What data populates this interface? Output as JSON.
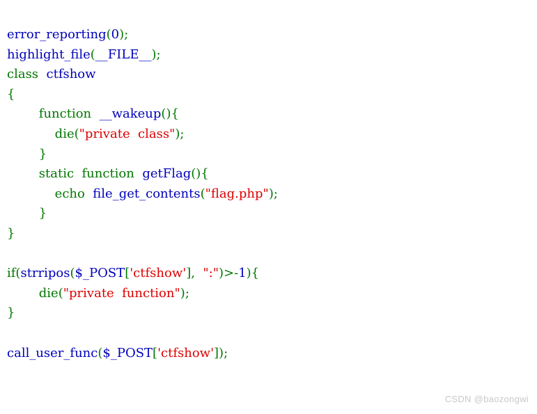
{
  "page": {
    "background_color": "#ffffff",
    "title": "PHP source highlight output"
  },
  "theme": {
    "default_color": "#0000BB",
    "keyword_color": "#007700",
    "string_color": "#DD0000",
    "comment_color": "#FF8000",
    "background_color": "#ffffff"
  },
  "watermark": {
    "text": "CSDN @baozongwi"
  },
  "code": {
    "language": "php",
    "plain_text": "error_reporting(0);\nhighlight_file(__FILE__);\nclass  ctfshow\n{\n        function  __wakeup(){\n            die(\"private  class\");\n        }\n        static  function  getFlag(){\n            echo  file_get_contents(\"flag.php\");\n        }\n}\n\nif(strripos($_POST['ctfshow'],  \":\")>-1){\n        die(\"private  function\");\n}\n\ncall_user_func($_POST['ctfshow']);",
    "lines": [
      {
        "indent": "",
        "tokens": [
          {
            "text": "error_reporting",
            "type": "default"
          },
          {
            "text": "(",
            "type": "keyword"
          },
          {
            "text": "0",
            "type": "default"
          },
          {
            "text": ")",
            "type": "keyword"
          },
          {
            "text": ";",
            "type": "keyword"
          }
        ]
      },
      {
        "indent": "",
        "tokens": [
          {
            "text": "highlight_file",
            "type": "default"
          },
          {
            "text": "(",
            "type": "keyword"
          },
          {
            "text": "__FILE__",
            "type": "default"
          },
          {
            "text": ")",
            "type": "keyword"
          },
          {
            "text": ";",
            "type": "keyword"
          }
        ]
      },
      {
        "indent": "",
        "tokens": [
          {
            "text": "class",
            "type": "keyword"
          },
          {
            "text": "  ",
            "type": "keyword"
          },
          {
            "text": "ctfshow",
            "type": "default"
          }
        ]
      },
      {
        "indent": "",
        "tokens": [
          {
            "text": "{",
            "type": "keyword"
          }
        ]
      },
      {
        "indent": "        ",
        "tokens": [
          {
            "text": "function",
            "type": "keyword"
          },
          {
            "text": "  ",
            "type": "keyword"
          },
          {
            "text": "__wakeup",
            "type": "default"
          },
          {
            "text": "(){",
            "type": "keyword"
          }
        ]
      },
      {
        "indent": "            ",
        "tokens": [
          {
            "text": "die",
            "type": "keyword"
          },
          {
            "text": "(",
            "type": "keyword"
          },
          {
            "text": "\"private  class\"",
            "type": "string"
          },
          {
            "text": ")",
            "type": "keyword"
          },
          {
            "text": ";",
            "type": "keyword"
          }
        ]
      },
      {
        "indent": "        ",
        "tokens": [
          {
            "text": "}",
            "type": "keyword"
          }
        ]
      },
      {
        "indent": "        ",
        "tokens": [
          {
            "text": "static",
            "type": "keyword"
          },
          {
            "text": "  ",
            "type": "keyword"
          },
          {
            "text": "function",
            "type": "keyword"
          },
          {
            "text": "  ",
            "type": "keyword"
          },
          {
            "text": "getFlag",
            "type": "default"
          },
          {
            "text": "(){",
            "type": "keyword"
          }
        ]
      },
      {
        "indent": "            ",
        "tokens": [
          {
            "text": "echo",
            "type": "keyword"
          },
          {
            "text": "  ",
            "type": "keyword"
          },
          {
            "text": "file_get_contents",
            "type": "default"
          },
          {
            "text": "(",
            "type": "keyword"
          },
          {
            "text": "\"flag.php\"",
            "type": "string"
          },
          {
            "text": ")",
            "type": "keyword"
          },
          {
            "text": ";",
            "type": "keyword"
          }
        ]
      },
      {
        "indent": "        ",
        "tokens": [
          {
            "text": "}",
            "type": "keyword"
          }
        ]
      },
      {
        "indent": "",
        "tokens": [
          {
            "text": "}",
            "type": "keyword"
          }
        ]
      },
      {
        "indent": "",
        "tokens": []
      },
      {
        "indent": "",
        "tokens": [
          {
            "text": "if",
            "type": "keyword"
          },
          {
            "text": "(",
            "type": "keyword"
          },
          {
            "text": "strripos",
            "type": "default"
          },
          {
            "text": "(",
            "type": "keyword"
          },
          {
            "text": "$_POST",
            "type": "default"
          },
          {
            "text": "[",
            "type": "keyword"
          },
          {
            "text": "'ctfshow'",
            "type": "string"
          },
          {
            "text": "],",
            "type": "keyword"
          },
          {
            "text": "  ",
            "type": "keyword"
          },
          {
            "text": "\":\"",
            "type": "string"
          },
          {
            "text": ")>-",
            "type": "keyword"
          },
          {
            "text": "1",
            "type": "default"
          },
          {
            "text": "){",
            "type": "keyword"
          }
        ]
      },
      {
        "indent": "        ",
        "tokens": [
          {
            "text": "die",
            "type": "keyword"
          },
          {
            "text": "(",
            "type": "keyword"
          },
          {
            "text": "\"private  function\"",
            "type": "string"
          },
          {
            "text": ")",
            "type": "keyword"
          },
          {
            "text": ";",
            "type": "keyword"
          }
        ]
      },
      {
        "indent": "",
        "tokens": [
          {
            "text": "}",
            "type": "keyword"
          }
        ]
      },
      {
        "indent": "",
        "tokens": []
      },
      {
        "indent": "",
        "tokens": [
          {
            "text": "call_user_func",
            "type": "default"
          },
          {
            "text": "(",
            "type": "keyword"
          },
          {
            "text": "$_POST",
            "type": "default"
          },
          {
            "text": "[",
            "type": "keyword"
          },
          {
            "text": "'ctfshow'",
            "type": "string"
          },
          {
            "text": "])",
            "type": "keyword"
          },
          {
            "text": ";",
            "type": "keyword"
          }
        ]
      }
    ]
  }
}
